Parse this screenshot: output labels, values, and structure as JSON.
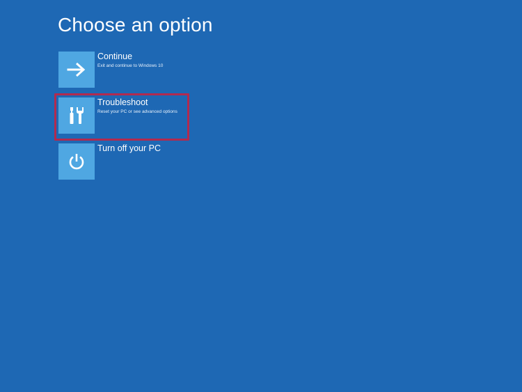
{
  "page": {
    "title": "Choose an option"
  },
  "options": [
    {
      "id": "continue",
      "label": "Continue",
      "description": "Exit and continue to Windows 10",
      "icon": "arrow-right-icon"
    },
    {
      "id": "troubleshoot",
      "label": "Troubleshoot",
      "description": "Reset your PC or see advanced options",
      "icon": "tools-icon"
    },
    {
      "id": "turn-off",
      "label": "Turn off your PC",
      "description": "",
      "icon": "power-icon"
    }
  ],
  "colors": {
    "background": "#1e68b4",
    "tile": "#4fa7e2",
    "highlight": "#b22a4f",
    "text": "#ffffff"
  }
}
